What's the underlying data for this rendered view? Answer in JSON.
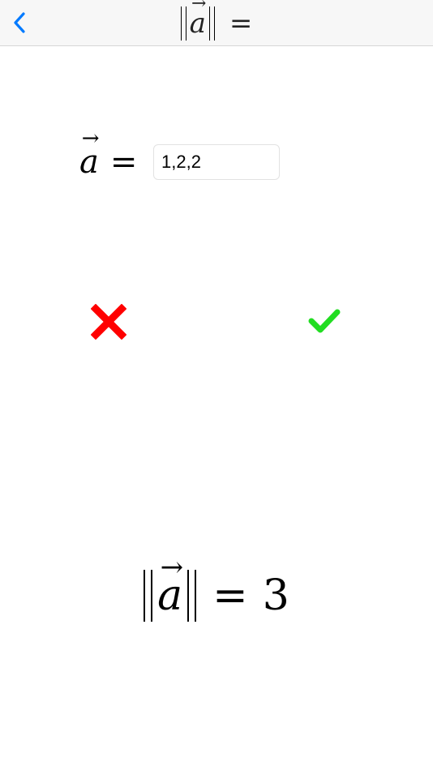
{
  "nav": {
    "title": {
      "variable": "a",
      "arrow": "→",
      "equals": "="
    }
  },
  "input": {
    "variable": "a",
    "arrow": "→",
    "equals": "=",
    "value": "1,2,2"
  },
  "result": {
    "variable": "a",
    "arrow": "→",
    "equals": "=",
    "value": "3"
  },
  "colors": {
    "back_accent": "#007aff",
    "clear_red": "#ff0000",
    "check_green": "#22dd22"
  },
  "icons": {
    "back": "chevron-left-icon",
    "clear": "x-mark-icon",
    "check": "checkmark-icon"
  }
}
